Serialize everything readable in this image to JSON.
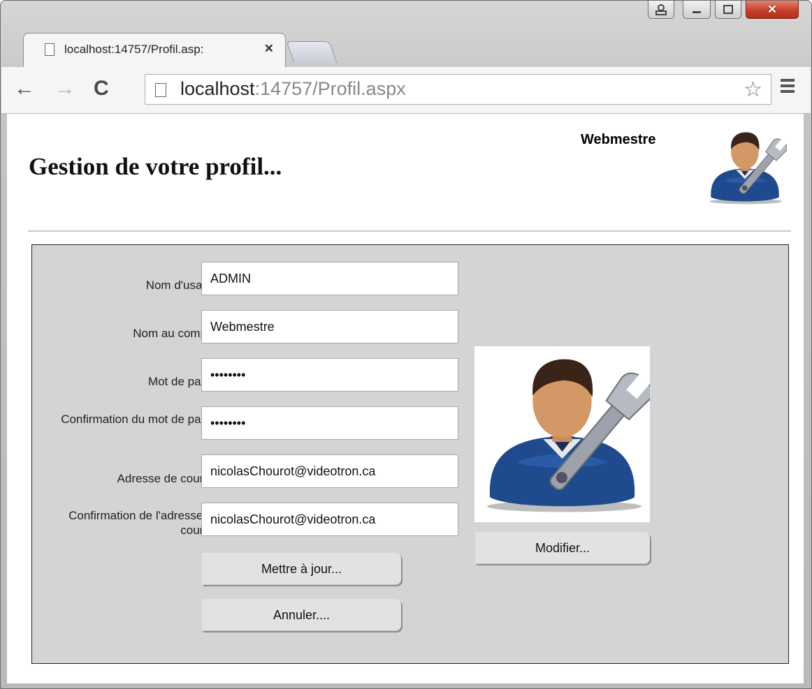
{
  "browser": {
    "tab_title": "localhost:14757/Profil.asp:",
    "url_host": "localhost",
    "url_rest": ":14757/Profil.aspx"
  },
  "header": {
    "title": "Gestion de votre profil...",
    "user_name": "Webmestre"
  },
  "form": {
    "username_label": "Nom d'usager",
    "username_value": "ADMIN",
    "fullname_label": "Nom au complet",
    "fullname_value": "Webmestre",
    "password_label": "Mot de passe",
    "password_value": "passwd12",
    "password_confirm_label": "Confirmation du mot de passe",
    "password_confirm_value": "passwd12",
    "email_label": "Adresse de courriel",
    "email_value": "nicolasChourot@videotron.ca",
    "email_confirm_label": "Confirmation de l'adresse de courriel",
    "email_confirm_value": "nicolasChourot@videotron.ca",
    "update_button": "Mettre à jour...",
    "cancel_button": "Annuler....",
    "modify_button": "Modifier..."
  },
  "icons": {
    "avatar": "webmaster-avatar-icon",
    "back": "back-arrow-icon",
    "forward": "forward-arrow-icon",
    "reload": "reload-icon",
    "bookmark": "star-icon",
    "menu": "hamburger-menu-icon"
  }
}
